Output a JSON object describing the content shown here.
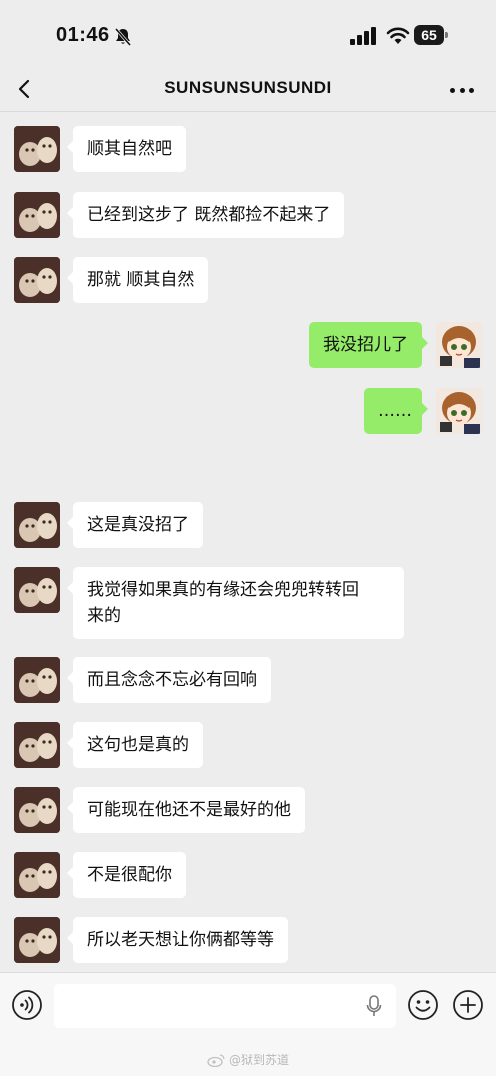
{
  "status_bar": {
    "time": "01:46",
    "battery": "65",
    "icons": [
      "bell-slash-icon",
      "signal-icon",
      "wifi-icon",
      "battery-icon"
    ]
  },
  "nav": {
    "title": "SUNSUNSUNSUNDI",
    "back_icon": "chevron-left-icon",
    "more_icon": "more-dots-icon"
  },
  "messages": [
    {
      "side": "left",
      "avatar": "cat-photo-avatar",
      "text": "顺其自然吧"
    },
    {
      "side": "left",
      "avatar": "cat-photo-avatar",
      "text": "已经到这步了 既然都捡不起来了"
    },
    {
      "side": "left",
      "avatar": "cat-photo-avatar",
      "text": "那就 顺其自然"
    },
    {
      "side": "right",
      "avatar": "anime-girl-avatar",
      "text": "我没招儿了"
    },
    {
      "side": "right",
      "avatar": "anime-girl-avatar",
      "text": "……"
    },
    {
      "side": "left",
      "avatar": "cat-photo-avatar",
      "text": "这是真没招了"
    },
    {
      "side": "left",
      "avatar": "cat-photo-avatar",
      "text_line1": "我觉得如果真的有缘还会兜兜转转回",
      "text_line2": "来的"
    },
    {
      "side": "left",
      "avatar": "cat-photo-avatar",
      "text": "而且念念不忘必有回响"
    },
    {
      "side": "left",
      "avatar": "cat-photo-avatar",
      "text": "这句也是真的"
    },
    {
      "side": "left",
      "avatar": "cat-photo-avatar",
      "text": "可能现在他还不是最好的他"
    },
    {
      "side": "left",
      "avatar": "cat-photo-avatar",
      "text": "不是很配你"
    },
    {
      "side": "left",
      "avatar": "cat-photo-avatar",
      "text": "所以老天想让你俩都等等"
    }
  ],
  "input_bar": {
    "voice_icon": "voice-icon",
    "mic_icon": "mic-icon",
    "emoji_icon": "emoji-icon",
    "plus_icon": "plus-icon",
    "text_value": "",
    "placeholder": ""
  },
  "watermark": {
    "icon": "weibo-icon",
    "text": "@狱到苏道"
  },
  "colors": {
    "background": "#ededed",
    "bubble_left": "#ffffff",
    "bubble_right": "#95ec69"
  }
}
